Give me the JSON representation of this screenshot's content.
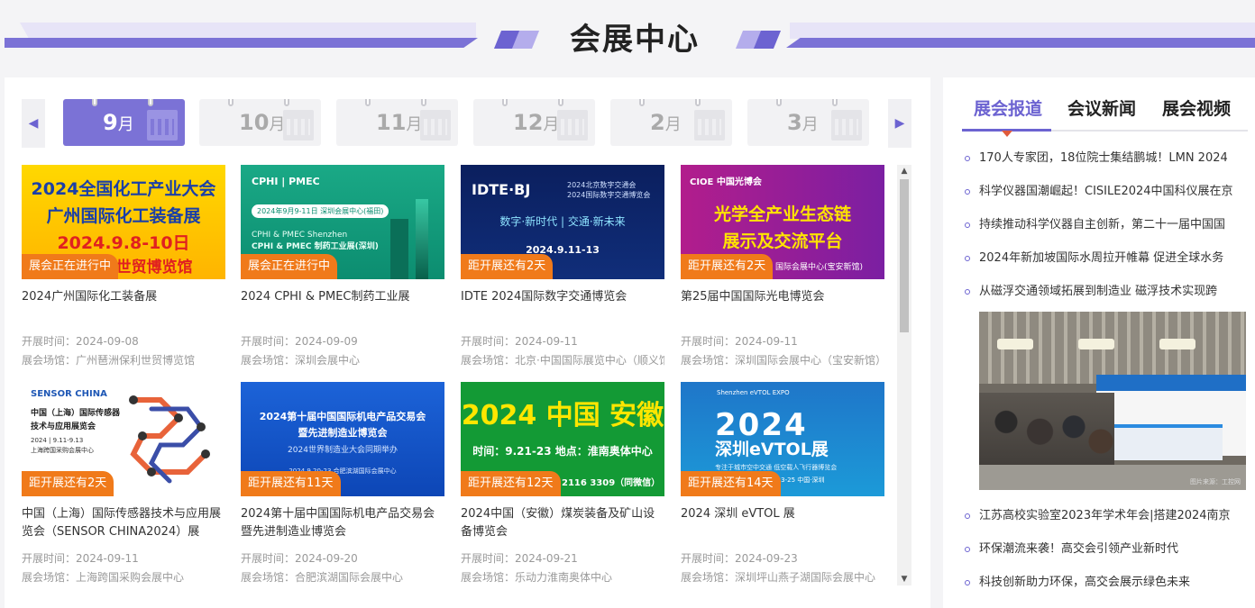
{
  "header": {
    "title": "会展中心"
  },
  "months": {
    "prev_icon": "chevron-left-icon",
    "next_icon": "chevron-right-icon",
    "unit": "月",
    "items": [
      {
        "num": "9",
        "active": true
      },
      {
        "num": "10",
        "active": false
      },
      {
        "num": "11",
        "active": false
      },
      {
        "num": "12",
        "active": false
      },
      {
        "num": "2",
        "active": false
      },
      {
        "num": "3",
        "active": false
      }
    ]
  },
  "labels": {
    "date": "开展时间：",
    "venue": "展会场馆："
  },
  "cards": [
    {
      "title": "2024广州国际化工装备展",
      "badge": "展会正在进行中",
      "date": "2024-09-08",
      "venue": "广州琶洲保利世贸博览馆",
      "art": {
        "l1": "2024全国化工产业大会",
        "l2": "广州国际化工装备展",
        "l3": "2024.9.8-10日",
        "l4": "广州保利世贸博览馆"
      }
    },
    {
      "title": "2024 CPHI & PMEC制药工业展",
      "badge": "展会正在进行中",
      "date": "2024-09-09",
      "venue": "深圳会展中心",
      "art": {
        "logo": "CPHI | PMEC",
        "date": "2024年9月9-11日  深圳会展中心(福田)",
        "t1": "CPHI & PMEC Shenzhen",
        "t2": "CPHI & PMEC 制药工业展(深圳)"
      }
    },
    {
      "title": "IDTE 2024国际数字交通博览会",
      "badge": "距开展还有2天",
      "date": "2024-09-11",
      "venue": "北京·中国国际展览中心（顺义馆）",
      "art": {
        "logo": "IDTE·BJ",
        "logo2": "2024北京数字交通会\n2024国际数字交通博览会",
        "mid": "数字·新时代 | 交通·新未来",
        "date": "2024.9.11-13"
      }
    },
    {
      "title": "第25届中国国际光电博览会",
      "badge": "距开展还有2天",
      "date": "2024-09-11",
      "venue": "深圳国际会展中心（宝安新馆）",
      "art": {
        "logo": "CIOE 中国光博会",
        "big1": "光学全产业生态链",
        "big2": "展示及交流平台",
        "sub": "国际会展中心(宝安新馆)"
      }
    },
    {
      "title": "中国（上海）国际传感器技术与应用展览会（SENSOR CHINA2024）展",
      "badge": "距开展还有2天",
      "date": "2024-09-11",
      "venue": "上海跨国采购会展中心",
      "art": {
        "logo": "SENSOR CHINA",
        "l1": "中国（上海）国际传感器\n技术与应用展览会",
        "date": "2024 | 9.11-9.13\n上海跨国采购会展中心"
      }
    },
    {
      "title": "2024第十届中国国际机电产品交易会暨先进制造业博览会",
      "badge": "距开展还有11天",
      "date": "2024-09-20",
      "venue": "合肥滨湖国际会展中心",
      "art": {
        "l1": "2024第十届中国国际机电产品交易会",
        "l2": "暨先进制造业博览会",
        "l3": "2024世界制造业大会同期举办",
        "date": "2024.9.20-23  合肥滨湖国际会展中心"
      }
    },
    {
      "title": "2024中国（安徽）煤炭装备及矿山设备博览会",
      "badge": "距开展还有12天",
      "date": "2024-09-21",
      "venue": "乐动力淮南奥体中心",
      "art": {
        "l1": "2024 中国 安徽",
        "l2": "时间：9.21-23  地点：淮南奥体中心",
        "l3": "2116 3309（同微信）"
      }
    },
    {
      "title": "2024 深圳 eVTOL 展",
      "badge": "距开展还有14天",
      "date": "2024-09-23",
      "venue": "深圳坪山燕子湖国际会展中心",
      "art": {
        "logo": "Shenzhen eVTOL EXPO",
        "l1": "2024",
        "l2": "深圳eVTOL展",
        "l3": "专注于城市空中交通 低空载人飞行器博览会",
        "l4": "9.23-25   中国·深圳"
      }
    }
  ],
  "right": {
    "tabs": [
      "展会报道",
      "会议新闻",
      "展会视频"
    ],
    "news_top": [
      "170人专家团，18位院士集结鹏城！LMN 2024",
      "科学仪器国潮崛起！CISILE2024中国科仪展在京",
      "持续推动科学仪器自主创新，第二十一届中国国",
      "2024年新加坡国际水周拉开帷幕 促进全球水务",
      "从磁浮交通领域拓展到制造业 磁浮技术实现跨"
    ],
    "news_bottom": [
      "江苏高校实验室2023年学术年会|搭建2024南京",
      "环保潮流来袭！高交会引领产业新时代",
      "科技创新助力环保，高交会展示绿色未来"
    ],
    "photo_credit": "图片来源：工控网"
  }
}
